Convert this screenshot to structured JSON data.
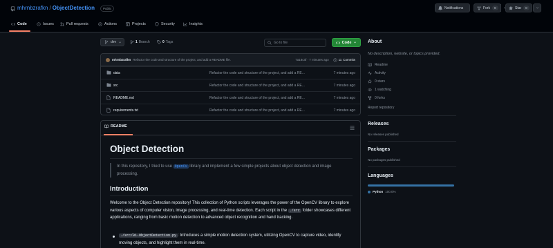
{
  "header": {
    "owner": "mhrnbzrafkn",
    "separator": "/",
    "repo": "ObjectDetection",
    "visibility": "Public",
    "notifications_label": "Notifications",
    "fork_label": "Fork",
    "fork_count": "0",
    "star_label": "Star",
    "star_count": "0"
  },
  "tabs": [
    {
      "label": "Code",
      "icon": "code-icon",
      "active": true
    },
    {
      "label": "Issues",
      "icon": "issue-icon"
    },
    {
      "label": "Pull requests",
      "icon": "pull-request-icon"
    },
    {
      "label": "Actions",
      "icon": "play-icon"
    },
    {
      "label": "Projects",
      "icon": "table-icon"
    },
    {
      "label": "Security",
      "icon": "shield-icon"
    },
    {
      "label": "Insights",
      "icon": "graph-icon"
    }
  ],
  "toolbar": {
    "branch": "dev",
    "branches_count": "1",
    "branches_label": "Branch",
    "tags_count": "0",
    "tags_label": "Tags",
    "search_placeholder": "Go to file",
    "code_label": "Code"
  },
  "latest_commit": {
    "author": "mhrnbzrafkn",
    "message": "Refactor the code and structure of the project, and add a README file.",
    "meta": "7a18caf · 7 minutes ago",
    "commits_count": "11",
    "commits_label": "Commits"
  },
  "files": [
    {
      "name": "data",
      "type": "folder",
      "message": "Refactor the code and structure of the project, and add a RE...",
      "time": "7 minutes ago"
    },
    {
      "name": "src",
      "type": "folder",
      "message": "Refactor the code and structure of the project, and add a RE...",
      "time": "7 minutes ago"
    },
    {
      "name": "README.md",
      "type": "file",
      "message": "Refactor the code and structure of the project, and add a RE...",
      "time": "7 minutes ago"
    },
    {
      "name": "requirements.txt",
      "type": "file",
      "message": "Refactor the code and structure of the project, and add a RE...",
      "time": "7 minutes ago"
    }
  ],
  "readme": {
    "tab_label": "README",
    "title": "Object Detection",
    "quote_pre": "In this repository, I tried to use",
    "quote_code": "OpenCV",
    "quote_post": "library and implement a few simple projects about object detection and image processing.",
    "section_title": "Introduction",
    "intro_pre": "Welcome to the Object Detection repository! This collection of Python scripts leverages the power of the OpenCV library to explore various aspects of computer vision, image processing, and real-time detection. Each script in the",
    "intro_code": "./src",
    "intro_post": "folder showcases different applications, ranging from basic motion detection to advanced object recognition and hand tracking.",
    "li_code": "./src/01-ObjectDetection.py",
    "li_text": ": Introduces a simple motion detection system, utilizing OpenCV to capture video, identify moving objects, and highlight them in real-time."
  },
  "sidebar": {
    "about_title": "About",
    "description": "No description, website, or topics provided.",
    "readme": "Readme",
    "activity": "Activity",
    "stars": "0 stars",
    "watching": "1 watching",
    "forks": "0 forks",
    "report": "Report repository",
    "releases_title": "Releases",
    "releases_empty": "No releases published",
    "packages_title": "Packages",
    "packages_empty": "No packages published",
    "languages_title": "Languages",
    "language_name": "Python",
    "language_pct": "100.0%",
    "language_color": "#3572A5"
  }
}
